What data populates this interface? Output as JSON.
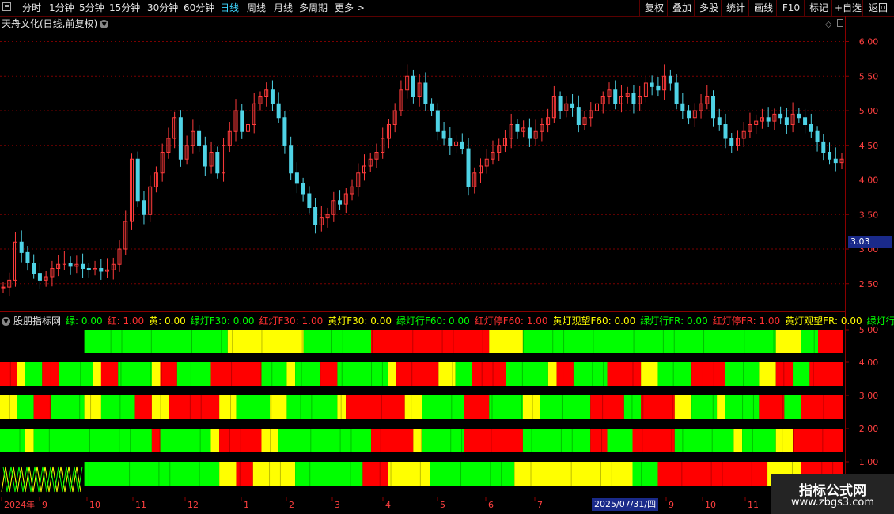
{
  "toolbar": {
    "periods": [
      "分时",
      "1分钟",
      "5分钟",
      "15分钟",
      "30分钟",
      "60分钟",
      "日线",
      "周线",
      "月线",
      "多周期",
      "更多 >"
    ],
    "active_period": "日线",
    "right_buttons": [
      "复权",
      "叠加",
      "多股",
      "统计",
      "画线",
      "F10",
      "标记",
      "+自选",
      "返回"
    ]
  },
  "stock_title": "天舟文化(日线,前复权)",
  "price_axis": {
    "labels": [
      "6.00",
      "5.50",
      "5.00",
      "4.50",
      "4.00",
      "3.50",
      "3.00",
      "2.50"
    ],
    "values": [
      6.0,
      5.5,
      5.0,
      4.5,
      4.0,
      3.5,
      3.0,
      2.5
    ]
  },
  "current_price": "3.03",
  "indicator": {
    "name": "股朋指标网",
    "readouts": [
      {
        "text": "绿: 0.00",
        "color": "#00ff00"
      },
      {
        "text": "红: 1.00",
        "color": "#ff3030"
      },
      {
        "text": "黄: 0.00",
        "color": "#ffff00"
      },
      {
        "text": "绿灯F30: 0.00",
        "color": "#00ff00"
      },
      {
        "text": "红灯F30: 1.00",
        "color": "#ff3030"
      },
      {
        "text": "黄灯F30: 0.00",
        "color": "#ffff00"
      },
      {
        "text": "绿灯行F60: 0.00",
        "color": "#00ff00"
      },
      {
        "text": "红灯停F60: 1.00",
        "color": "#ff3030"
      },
      {
        "text": "黄灯观望F60: 0.00",
        "color": "#ffff00"
      },
      {
        "text": "绿灯行FR: 0.00",
        "color": "#00ff00"
      },
      {
        "text": "红灯停FR: 1.00",
        "color": "#ff3030"
      },
      {
        "text": "黄灯观望FR: 0.00",
        "color": "#ffff00"
      },
      {
        "text": "绿灯行DR",
        "color": "#00ff00"
      }
    ],
    "axis_labels": [
      "5.00",
      "4.00",
      "3.00",
      "2.00",
      "1.00"
    ],
    "axis_values": [
      5,
      4,
      3,
      2,
      1
    ]
  },
  "x_axis": {
    "labels": [
      "2024年",
      "9",
      "10",
      "11",
      "12",
      "1",
      "2",
      "3",
      "4",
      "5",
      "6",
      "7",
      "8",
      "9",
      "10",
      "11"
    ]
  },
  "crosshair_date": "2025/07/31/四",
  "colors": {
    "green": "#00ff00",
    "red": "#ff0000",
    "yellow": "#ffff00",
    "up": "#ff3b3b",
    "down": "#4fd3e6",
    "grid": "#8b0000",
    "bg": "#000000"
  },
  "watermark": {
    "line1": "指标公式网",
    "line2": "www.zbgs3.com"
  },
  "chart_data": {
    "type": "candlestick",
    "ylim": [
      2.2,
      6.2
    ],
    "close": [
      2.45,
      2.55,
      3.1,
      2.95,
      2.8,
      2.65,
      2.55,
      2.6,
      2.72,
      2.78,
      2.8,
      2.75,
      2.78,
      2.72,
      2.7,
      2.72,
      2.68,
      2.7,
      2.78,
      3.0,
      3.4,
      4.3,
      3.7,
      3.5,
      3.9,
      4.1,
      4.4,
      4.6,
      4.9,
      4.3,
      4.5,
      4.7,
      4.5,
      4.2,
      4.4,
      4.1,
      4.5,
      4.7,
      5.0,
      4.7,
      4.8,
      5.1,
      5.2,
      5.3,
      5.1,
      4.9,
      4.5,
      4.1,
      3.95,
      3.8,
      3.6,
      3.35,
      3.45,
      3.5,
      3.7,
      3.65,
      3.8,
      3.9,
      4.1,
      4.2,
      4.3,
      4.4,
      4.6,
      4.8,
      5.0,
      5.3,
      5.5,
      5.2,
      5.4,
      5.1,
      5.0,
      4.7,
      4.6,
      4.5,
      4.55,
      4.45,
      3.9,
      4.1,
      4.2,
      4.3,
      4.4,
      4.5,
      4.6,
      4.8,
      4.7,
      4.75,
      4.6,
      4.7,
      4.8,
      4.9,
      5.2,
      5.0,
      5.1,
      5.05,
      4.8,
      4.9,
      5.0,
      5.1,
      5.2,
      5.3,
      5.1,
      5.2,
      5.25,
      5.1,
      5.2,
      5.4,
      5.35,
      5.3,
      5.5,
      5.4,
      5.1,
      5.0,
      4.9,
      5.0,
      5.1,
      5.2,
      4.9,
      4.8,
      4.6,
      4.5,
      4.6,
      4.7,
      4.8,
      4.85,
      4.9,
      4.85,
      4.95,
      4.9,
      4.8,
      4.95,
      4.9,
      4.8,
      4.7,
      4.55,
      4.4,
      4.3,
      4.25,
      4.3
    ]
  },
  "signal_bars": {
    "row5": [
      [
        "k",
        0.1
      ],
      [
        "g",
        0.27
      ],
      [
        "y",
        0.36
      ],
      [
        "g",
        0.44
      ],
      [
        "r",
        0.58
      ],
      [
        "y",
        0.62
      ],
      [
        "g",
        0.92
      ],
      [
        "y",
        0.95
      ],
      [
        "g",
        0.97
      ],
      [
        "r",
        1.0
      ]
    ],
    "row4": [
      [
        "r",
        0.02
      ],
      [
        "y",
        0.03
      ],
      [
        "g",
        0.05
      ],
      [
        "r",
        0.07
      ],
      [
        "g",
        0.11
      ],
      [
        "y",
        0.12
      ],
      [
        "r",
        0.14
      ],
      [
        "g",
        0.18
      ],
      [
        "y",
        0.19
      ],
      [
        "r",
        0.21
      ],
      [
        "g",
        0.25
      ],
      [
        "r",
        0.31
      ],
      [
        "g",
        0.34
      ],
      [
        "y",
        0.35
      ],
      [
        "g",
        0.38
      ],
      [
        "r",
        0.4
      ],
      [
        "g",
        0.46
      ],
      [
        "y",
        0.47
      ],
      [
        "r",
        0.52
      ],
      [
        "y",
        0.54
      ],
      [
        "g",
        0.56
      ],
      [
        "r",
        0.6
      ],
      [
        "g",
        0.65
      ],
      [
        "y",
        0.66
      ],
      [
        "r",
        0.68
      ],
      [
        "g",
        0.72
      ],
      [
        "r",
        0.76
      ],
      [
        "y",
        0.78
      ],
      [
        "g",
        0.82
      ],
      [
        "r",
        0.86
      ],
      [
        "g",
        0.9
      ],
      [
        "y",
        0.92
      ],
      [
        "r",
        0.94
      ],
      [
        "g",
        0.96
      ],
      [
        "r",
        1.0
      ]
    ],
    "row3": [
      [
        "y",
        0.02
      ],
      [
        "g",
        0.04
      ],
      [
        "r",
        0.06
      ],
      [
        "g",
        0.1
      ],
      [
        "y",
        0.12
      ],
      [
        "g",
        0.16
      ],
      [
        "r",
        0.18
      ],
      [
        "y",
        0.2
      ],
      [
        "r",
        0.26
      ],
      [
        "y",
        0.28
      ],
      [
        "g",
        0.32
      ],
      [
        "y",
        0.34
      ],
      [
        "g",
        0.4
      ],
      [
        "y",
        0.41
      ],
      [
        "r",
        0.48
      ],
      [
        "y",
        0.5
      ],
      [
        "g",
        0.55
      ],
      [
        "r",
        0.58
      ],
      [
        "g",
        0.62
      ],
      [
        "y",
        0.64
      ],
      [
        "g",
        0.7
      ],
      [
        "r",
        0.74
      ],
      [
        "g",
        0.76
      ],
      [
        "r",
        0.8
      ],
      [
        "y",
        0.82
      ],
      [
        "g",
        0.85
      ],
      [
        "y",
        0.86
      ],
      [
        "g",
        0.9
      ],
      [
        "r",
        0.93
      ],
      [
        "g",
        0.95
      ],
      [
        "r",
        1.0
      ]
    ],
    "row2": [
      [
        "g",
        0.03
      ],
      [
        "y",
        0.04
      ],
      [
        "g",
        0.18
      ],
      [
        "r",
        0.19
      ],
      [
        "g",
        0.25
      ],
      [
        "y",
        0.26
      ],
      [
        "r",
        0.31
      ],
      [
        "y",
        0.33
      ],
      [
        "g",
        0.44
      ],
      [
        "r",
        0.49
      ],
      [
        "y",
        0.5
      ],
      [
        "g",
        0.55
      ],
      [
        "r",
        0.62
      ],
      [
        "g",
        0.7
      ],
      [
        "r",
        0.72
      ],
      [
        "g",
        0.75
      ],
      [
        "r",
        0.8
      ],
      [
        "g",
        0.87
      ],
      [
        "y",
        0.88
      ],
      [
        "g",
        0.92
      ],
      [
        "y",
        0.94
      ],
      [
        "r",
        1.0
      ]
    ],
    "row1": [
      [
        "k",
        0.1
      ],
      [
        "g",
        0.26
      ],
      [
        "y",
        0.28
      ],
      [
        "r",
        0.3
      ],
      [
        "y",
        0.35
      ],
      [
        "g",
        0.43
      ],
      [
        "r",
        0.46
      ],
      [
        "y",
        0.51
      ],
      [
        "g",
        0.61
      ],
      [
        "y",
        0.75
      ],
      [
        "g",
        0.78
      ],
      [
        "r",
        0.91
      ],
      [
        "y",
        0.95
      ],
      [
        "r",
        1.0
      ]
    ]
  }
}
